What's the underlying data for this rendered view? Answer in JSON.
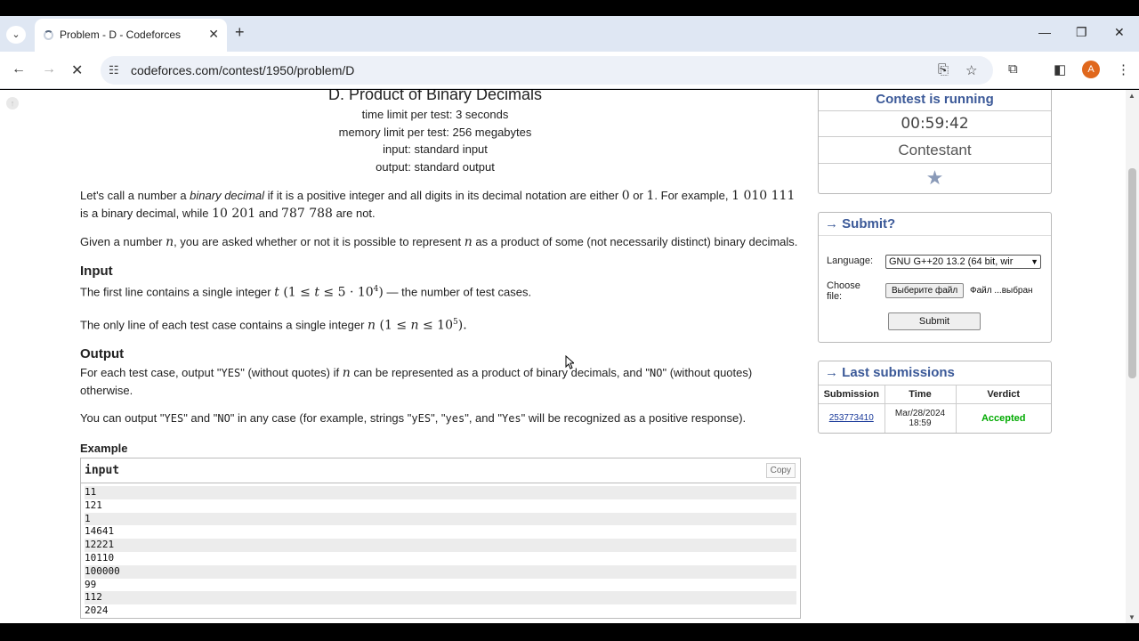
{
  "browser": {
    "tab_title": "Problem - D - Codeforces",
    "url": "codeforces.com/contest/1950/problem/D",
    "profile_initial": "A"
  },
  "problem": {
    "title": "D. Product of Binary Decimals",
    "time_limit": "time limit per test: 3 seconds",
    "memory_limit": "memory limit per test: 256 megabytes",
    "input": "input: standard input",
    "output": "output: standard output",
    "legend_p1": {
      "a": "Let's call a number a ",
      "b": "binary decimal",
      "c": " if it is a positive integer and all digits in its decimal notation are either ",
      "d": "0",
      "e": " or ",
      "f": "1",
      "g": ". For example, ",
      "h": "1 010 111",
      "i": "is a binary decimal, while ",
      "j": "10 201",
      "k": " and ",
      "l": "787 788",
      "m": " are not."
    },
    "legend_p2": {
      "a": "Given a number ",
      "b": "n",
      "c": ", you are asked whether or not it is possible to represent ",
      "d": "n",
      "e": " as a product of some (not necessarily distinct) binary decimals."
    },
    "input_section": {
      "heading": "Input",
      "p1a": "The first line contains a single integer ",
      "p1b": "t",
      "p1c": " (1 ≤ ",
      "p1d": "t",
      "p1e": " ≤ 5 · 10",
      "p1f": "4",
      "p1g": ")",
      "p1h": " — the number of test cases.",
      "p2a": "The only line of each test case contains a single integer ",
      "p2b": "n",
      "p2c": " (1 ≤ ",
      "p2d": "n",
      "p2e": " ≤ 10",
      "p2f": "5",
      "p2g": ")."
    },
    "output_section": {
      "heading": "Output",
      "p1a": "For each test case, output \"",
      "p1b": "YES",
      "p1c": "\" (without quotes) if ",
      "p1d": "n",
      "p1e": " can be represented as a product of binary decimals, and \"",
      "p1f": "NO",
      "p1g": "\" (without quotes) otherwise.",
      "p2a": "You can output \"",
      "p2b": "YES",
      "p2c": "\" and \"",
      "p2d": "NO",
      "p2e": "\" in any case (for example, strings \"",
      "p2f": "yES",
      "p2g": "\", \"",
      "p2h": "yes",
      "p2i": "\", and \"",
      "p2j": "Yes",
      "p2k": "\" will be recognized as a positive response)."
    },
    "example": {
      "heading": "Example",
      "input_label": "input",
      "copy_label": "Copy",
      "lines": [
        "11",
        "121",
        "1",
        "14641",
        "12221",
        "10110",
        "100000",
        "99",
        "112",
        "2024"
      ]
    }
  },
  "sidebar": {
    "contest": {
      "status": "Contest is running",
      "timer": "00:59:42",
      "role": "Contestant"
    },
    "submit": {
      "title": "→ Submit?",
      "language_label": "Language:",
      "language_value": "GNU G++20 13.2 (64 bit, wir",
      "file_label_1": "Choose",
      "file_label_2": "file:",
      "file_button": "Выберите файл",
      "file_status": "Файл ...выбран",
      "submit_button": "Submit"
    },
    "last_submissions": {
      "title": "→ Last submissions",
      "headers": [
        "Submission",
        "Time",
        "Verdict"
      ],
      "row": {
        "id": "253773410",
        "time_1": "Mar/28/2024",
        "time_2": "18:59",
        "verdict": "Accepted"
      }
    }
  }
}
